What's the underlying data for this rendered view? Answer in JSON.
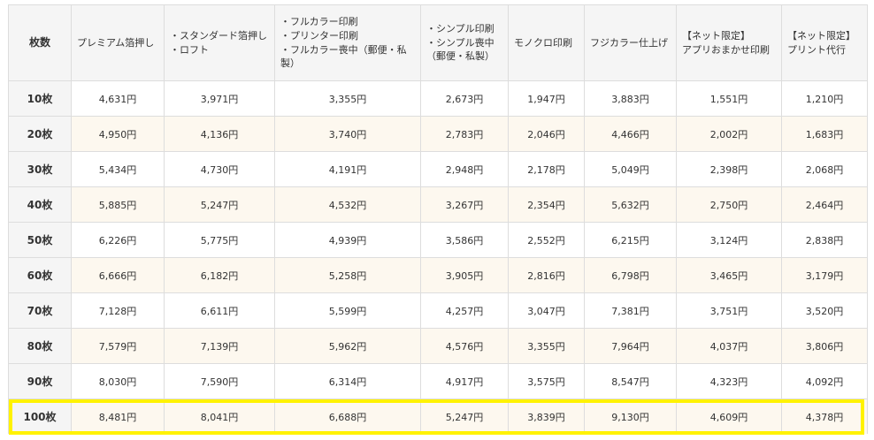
{
  "headers": [
    [
      "枚数"
    ],
    [
      "プレミアム箔押し"
    ],
    [
      "・スタンダード箔押し",
      "・ロフト"
    ],
    [
      "・フルカラー印刷",
      "・プリンター印刷",
      "・フルカラー喪中（郵便・私",
      "製）"
    ],
    [
      "・シンプル印刷",
      "・シンプル喪中",
      "（郵便・私製）"
    ],
    [
      "モノクロ印刷"
    ],
    [
      "フジカラー仕上げ"
    ],
    [
      "【ネット限定】",
      "アプリおまかせ印刷"
    ],
    [
      "【ネット限定】",
      "プリント代行"
    ]
  ],
  "rows": [
    [
      "10枚",
      "4,631円",
      "3,971円",
      "3,355円",
      "2,673円",
      "1,947円",
      "3,883円",
      "1,551円",
      "1,210円"
    ],
    [
      "20枚",
      "4,950円",
      "4,136円",
      "3,740円",
      "2,783円",
      "2,046円",
      "4,466円",
      "2,002円",
      "1,683円"
    ],
    [
      "30枚",
      "5,434円",
      "4,730円",
      "4,191円",
      "2,948円",
      "2,178円",
      "5,049円",
      "2,398円",
      "2,068円"
    ],
    [
      "40枚",
      "5,885円",
      "5,247円",
      "4,532円",
      "3,267円",
      "2,354円",
      "5,632円",
      "2,750円",
      "2,464円"
    ],
    [
      "50枚",
      "6,226円",
      "5,775円",
      "4,939円",
      "3,586円",
      "2,552円",
      "6,215円",
      "3,124円",
      "2,838円"
    ],
    [
      "60枚",
      "6,666円",
      "6,182円",
      "5,258円",
      "3,905円",
      "2,816円",
      "6,798円",
      "3,465円",
      "3,179円"
    ],
    [
      "70枚",
      "7,128円",
      "6,611円",
      "5,599円",
      "4,257円",
      "3,047円",
      "7,381円",
      "3,751円",
      "3,520円"
    ],
    [
      "80枚",
      "7,579円",
      "7,139円",
      "5,962円",
      "4,576円",
      "3,355円",
      "7,964円",
      "4,037円",
      "3,806円"
    ],
    [
      "90枚",
      "8,030円",
      "7,590円",
      "6,314円",
      "4,917円",
      "3,575円",
      "8,547円",
      "4,323円",
      "4,092円"
    ],
    [
      "100枚",
      "8,481円",
      "8,041円",
      "6,688円",
      "5,247円",
      "3,839円",
      "9,130円",
      "4,609円",
      "4,378円"
    ]
  ],
  "highlighted_row": "100枚",
  "colors": {
    "header_bg": "#f5f5f5",
    "alt_row_bg": "#fdf8ef",
    "border": "#dddddd",
    "highlight": "#fff200"
  }
}
